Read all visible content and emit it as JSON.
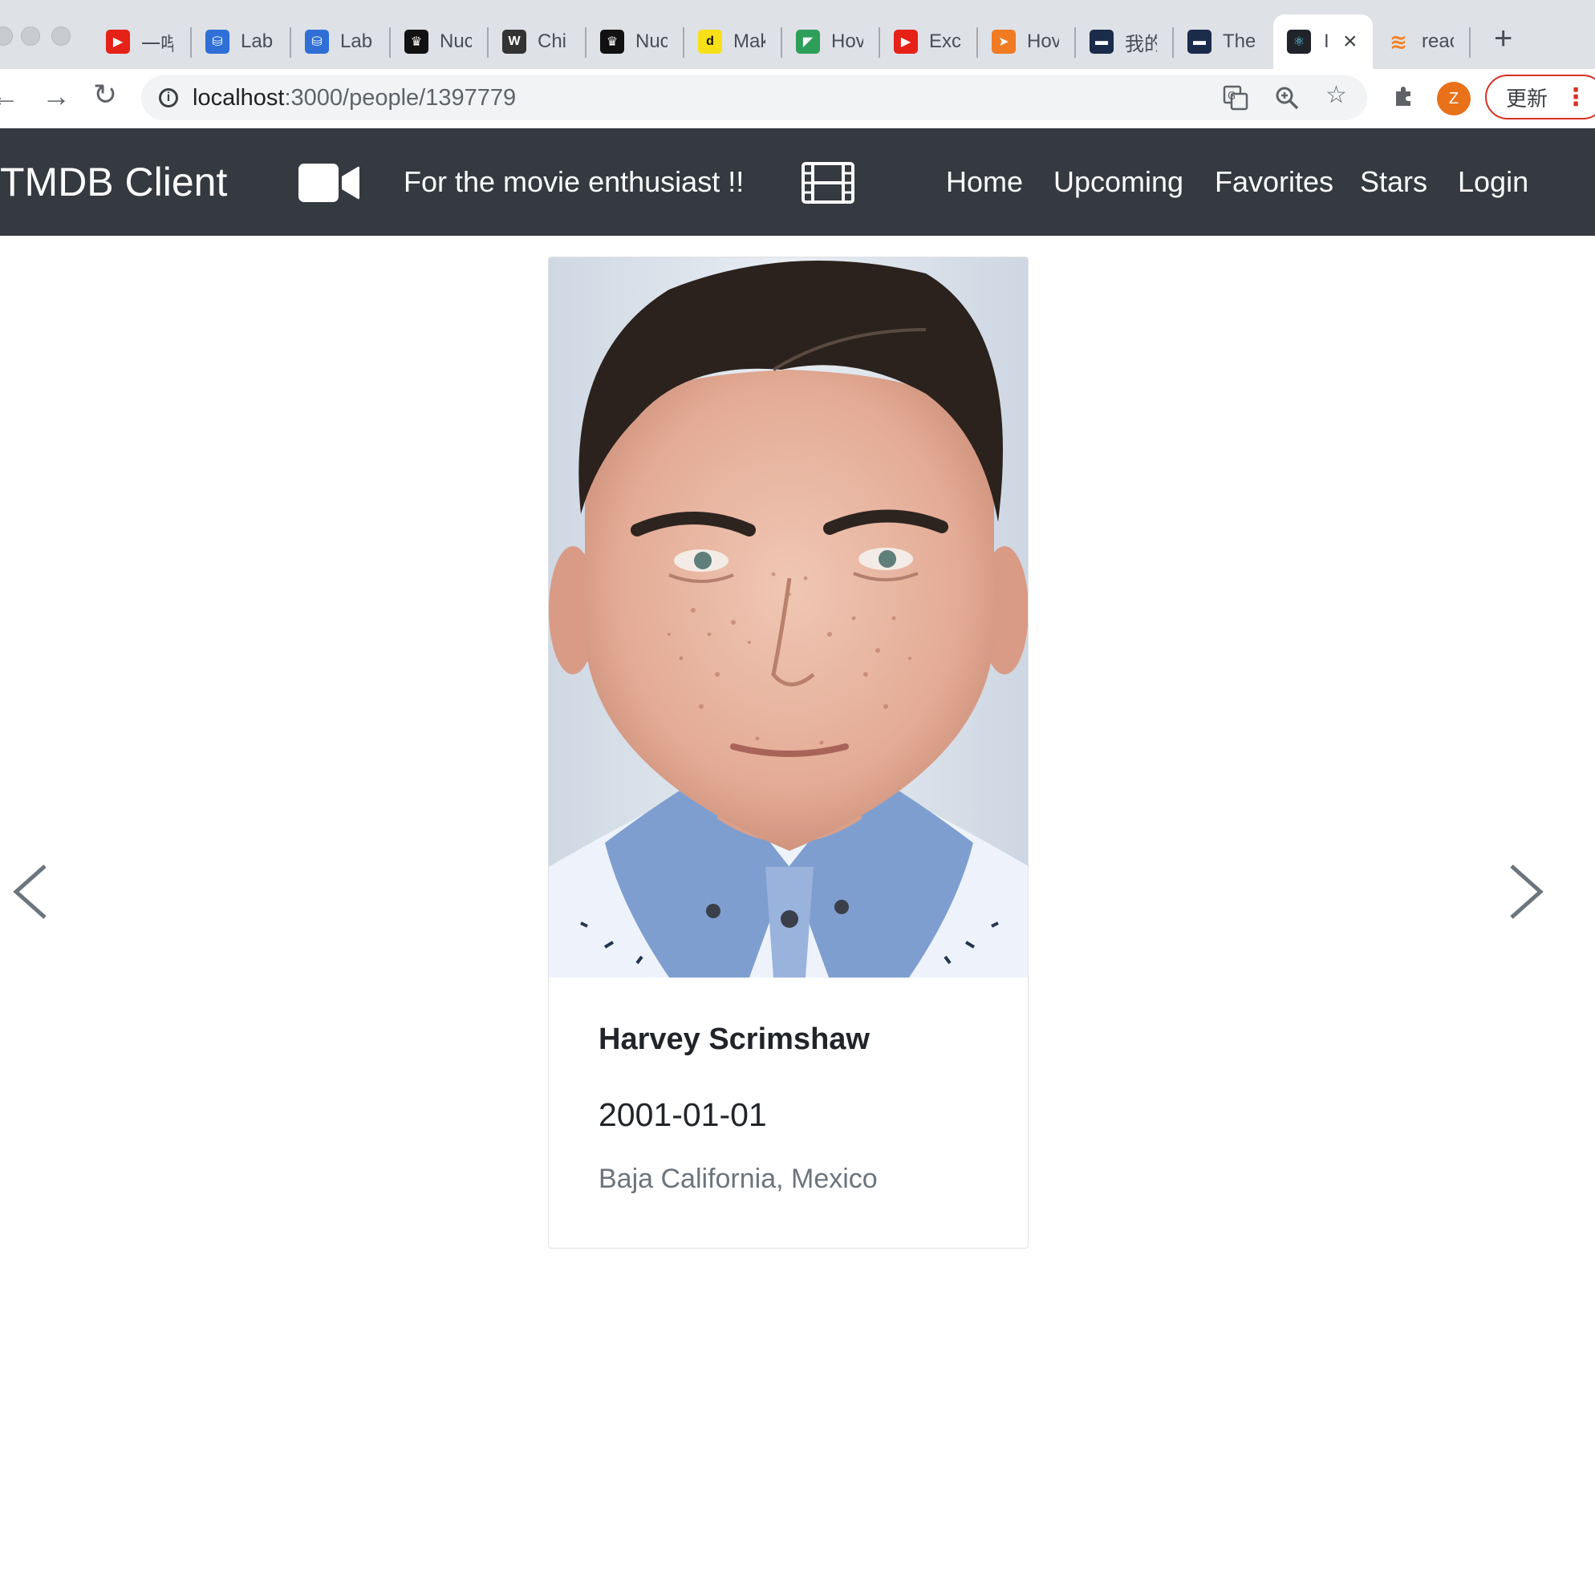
{
  "browser": {
    "tabs": [
      {
        "title": "一哔",
        "favicon": "youtube-icon",
        "color": "#e62117"
      },
      {
        "title": "Lab",
        "favicon": "lab-icon",
        "color": "#2f6fd6"
      },
      {
        "title": "Lab",
        "favicon": "lab-icon",
        "color": "#2f6fd6"
      },
      {
        "title": "Nuc",
        "favicon": "crown-icon",
        "color": "#111111"
      },
      {
        "title": "Chi",
        "favicon": "w-icon",
        "color": "#333333"
      },
      {
        "title": "Nuc",
        "favicon": "crown-icon",
        "color": "#111111"
      },
      {
        "title": "Mak",
        "favicon": "d-icon",
        "color": "#f7e018"
      },
      {
        "title": "Hov",
        "favicon": "leaf-icon",
        "color": "#2e9e5b"
      },
      {
        "title": "Exc",
        "favicon": "youtube-icon",
        "color": "#e62117"
      },
      {
        "title": "Hov",
        "favicon": "arrow-icon",
        "color": "#f07b22"
      },
      {
        "title": "我的",
        "favicon": "bar-icon",
        "color": "#1b2b4a"
      },
      {
        "title": "The",
        "favicon": "bar-icon",
        "color": "#1b2b4a"
      },
      {
        "title": "I",
        "favicon": "react-icon",
        "color": "#20232a",
        "active": true
      },
      {
        "title": "reac",
        "favicon": "stackoverflow-icon",
        "color": "#f48024"
      }
    ],
    "url_host": "localhost",
    "url_path": ":3000/people/1397779",
    "profile_initial": "Z",
    "update_label": "更新"
  },
  "nav": {
    "brand": "TMDB Client",
    "tagline": "For the movie enthusiast !!",
    "links": [
      "Home",
      "Upcoming",
      "Favorites",
      "Stars",
      "Login"
    ]
  },
  "person": {
    "name": "Harvey Scrimshaw",
    "birthday": "2001-01-01",
    "place_of_birth": "Baja California, Mexico"
  },
  "colors": {
    "navbar_bg": "#343a40",
    "muted_text": "#6c757d"
  }
}
